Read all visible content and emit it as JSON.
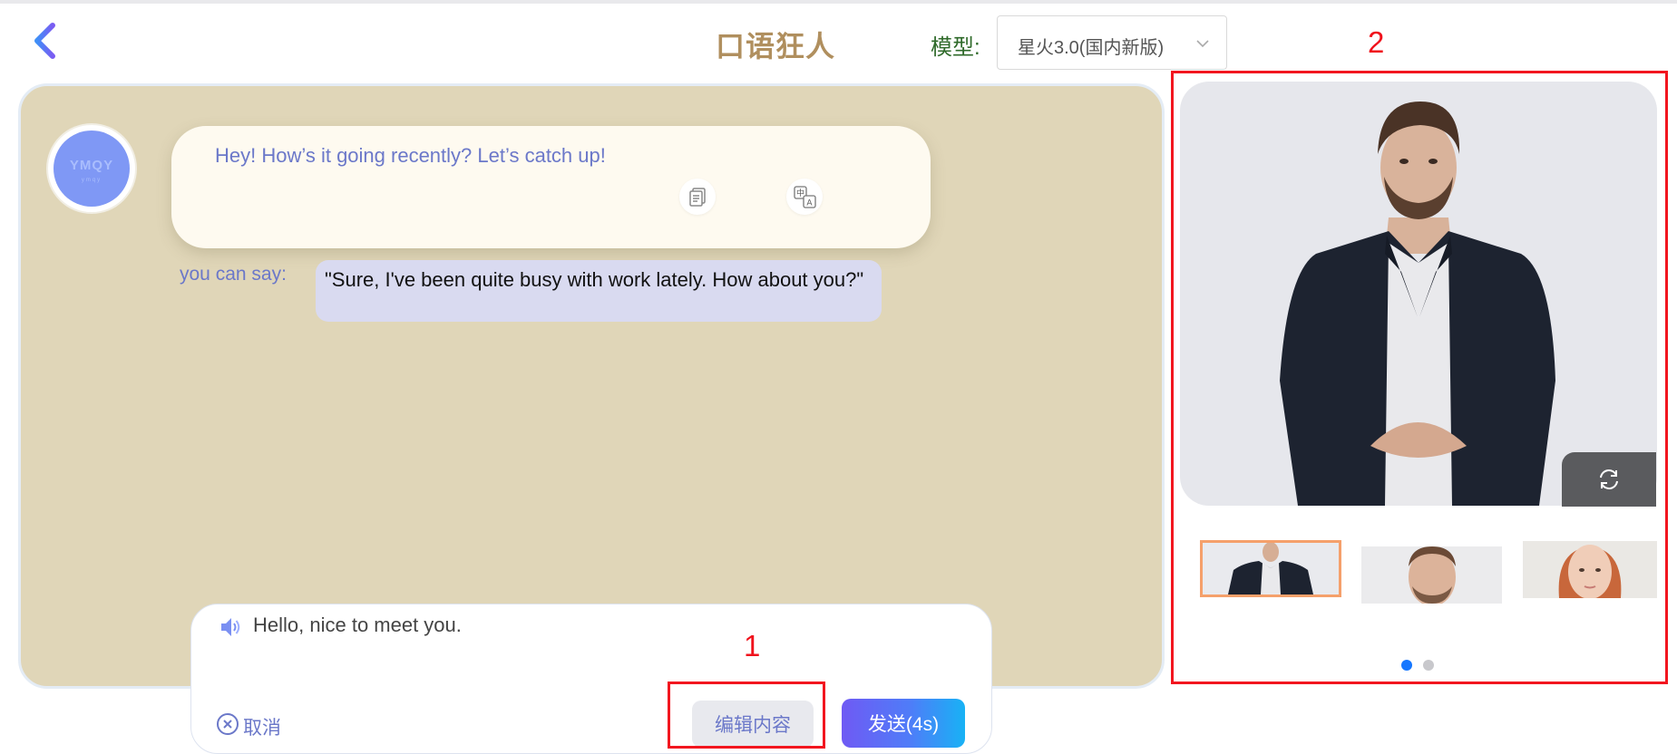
{
  "header": {
    "title": "口语狂人",
    "model_label": "模型:",
    "model_value": "星火3.0(国内新版)"
  },
  "chat": {
    "bot_message": "Hey! How’s it going recently? Let’s catch up!",
    "suggestion_label": "you can say:",
    "suggestion_text": "\"Sure, I've been quite busy with work lately. How about you?\"",
    "avatar_logo": "YMQY",
    "avatar_logo_sub": "ymqy"
  },
  "input": {
    "text": "Hello, nice to meet you.",
    "cancel_label": "取消",
    "edit_label": "编辑内容",
    "send_label": "发送(4s)"
  },
  "annotations": {
    "label_1": "1",
    "label_2": "2",
    "color": "#f2161f"
  },
  "carousel": {
    "thumbnails": [
      "man-in-suit",
      "man-headshot",
      "woman-headshot"
    ],
    "selected_thumbnail": 1,
    "active_dot": 1,
    "dot_count": 2
  },
  "colors": {
    "accent": "#6b78c9",
    "title": "#b08f5e",
    "chat_background": "#e0d6b8",
    "bubble": "#fefaf0",
    "send_gradient_start": "#6f5af4",
    "send_gradient_end": "#18b2f5",
    "selected_border": "#f5a06b",
    "active_dot": "#1677ff"
  }
}
